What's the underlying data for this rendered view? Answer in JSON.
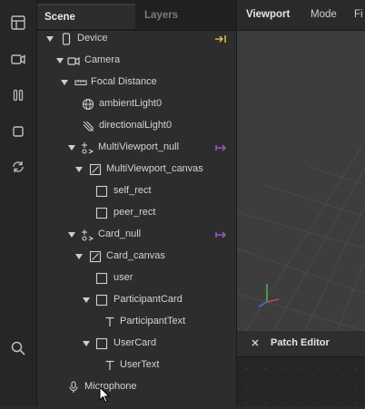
{
  "scene_panel": {
    "tabs": [
      {
        "label": "Scene",
        "active": true
      },
      {
        "label": "Layers",
        "active": false
      }
    ],
    "tree": [
      {
        "label": "Device",
        "icon": "device-icon",
        "expanded": true,
        "right_icon": "arrow-to-bar-icon"
      },
      {
        "label": "Camera",
        "icon": "camera-icon",
        "expanded": true
      },
      {
        "label": "Focal Distance",
        "icon": "ruler-icon",
        "expanded": true
      },
      {
        "label": "ambientLight0",
        "icon": "globe-icon"
      },
      {
        "label": "directionalLight0",
        "icon": "directional-light-icon"
      },
      {
        "label": "MultiViewport_null",
        "icon": "null-object-icon",
        "expanded": true,
        "right_icon": "patch-arrow-icon"
      },
      {
        "label": "MultiViewport_canvas",
        "icon": "canvas-icon",
        "expanded": true
      },
      {
        "label": "self_rect",
        "icon": "rectangle-icon"
      },
      {
        "label": "peer_rect",
        "icon": "rectangle-icon"
      },
      {
        "label": "Card_null",
        "icon": "null-object-icon",
        "expanded": true,
        "right_icon": "patch-arrow-icon"
      },
      {
        "label": "Card_canvas",
        "icon": "canvas-icon",
        "expanded": true
      },
      {
        "label": "user",
        "icon": "rectangle-icon"
      },
      {
        "label": "ParticipantCard",
        "icon": "rectangle-icon",
        "expanded": true
      },
      {
        "label": "ParticipantText",
        "icon": "text-icon"
      },
      {
        "label": "UserCard",
        "icon": "rectangle-icon",
        "expanded": true
      },
      {
        "label": "UserText",
        "icon": "text-icon"
      },
      {
        "label": "Microphone",
        "icon": "microphone-icon"
      }
    ]
  },
  "viewport": {
    "title": "Viewport",
    "mode_label": "Mode",
    "file_label_partial": "Fi"
  },
  "patch_editor": {
    "title": "Patch Editor"
  },
  "colors": {
    "accent_yellow": "#e6c845",
    "accent_purple": "#a35ad8",
    "axis_x": "#e04848",
    "axis_y": "#4bc24b",
    "axis_z": "#3f6fe0"
  }
}
